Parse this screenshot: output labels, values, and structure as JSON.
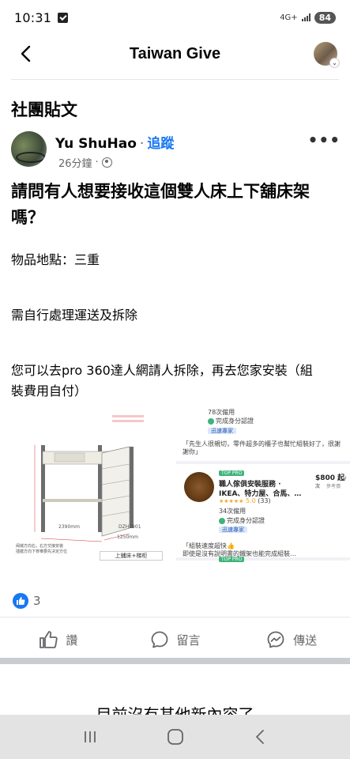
{
  "status_bar": {
    "time": "10:31",
    "network": "4G+",
    "battery": "84"
  },
  "header": {
    "title": "Taiwan Give"
  },
  "section_title": "社團貼文",
  "post": {
    "author": "Yu ShuHao",
    "separator": "·",
    "follow_label": "追蹤",
    "time": "26分鐘",
    "meta_sep": "·",
    "title_line1": "請問有人想要接收這個雙人床上下舖床架",
    "title_line2": "嗎？",
    "line1": "物品地點：三重",
    "line2": "需自行處理運送及拆除",
    "line3a": "您可以去pro 360達人網請人拆除，再去您家安裝（組",
    "line3b": "裝費用自付）"
  },
  "image": {
    "left_label_model": "DZH3901",
    "left_label_caption": "上鋪床+梯柜",
    "left_dim_width": "2390mm",
    "left_dim_depth": "1250mm",
    "left_note": "阀械方向右，右方交接安装\n插键方向下脊椎要先决定方位",
    "r_top_usage": "78次僱用",
    "r_top_verified": "完成身分認證",
    "r_top_badge": "迅速專家",
    "r_quote1": "「先生人很親切，零件超多的櫃子也幫忙組裝好了，很謝謝你」",
    "r_top_pro": "TOP PRO",
    "r_name1": "職人傢俱安裝服務 ·",
    "r_name2": "IKEA、特力屋、合馬、…",
    "r_price": "$800 起",
    "r_price_sub": "/ 次",
    "r_price_ref": "參考價",
    "r_rating": "5.0",
    "r_reviews": "(33)",
    "r_usage": "34次僱用",
    "r_verified": "完成身分認證",
    "r_badge": "迅速專家",
    "r_quote2a": "「組裝速度超快👍",
    "r_quote2b": "即使是沒有說明書的鐵架也能完成組裝…",
    "r_top_pro2": "TOP PRO"
  },
  "reactions": {
    "count": "3"
  },
  "actions": {
    "like": "讚",
    "comment": "留言",
    "share": "傳送"
  },
  "end_text": "目前沒有其他新內容了",
  "colors": {
    "accent": "#1877f2",
    "secondary_text": "#65676b",
    "divider": "#e4e6eb"
  }
}
